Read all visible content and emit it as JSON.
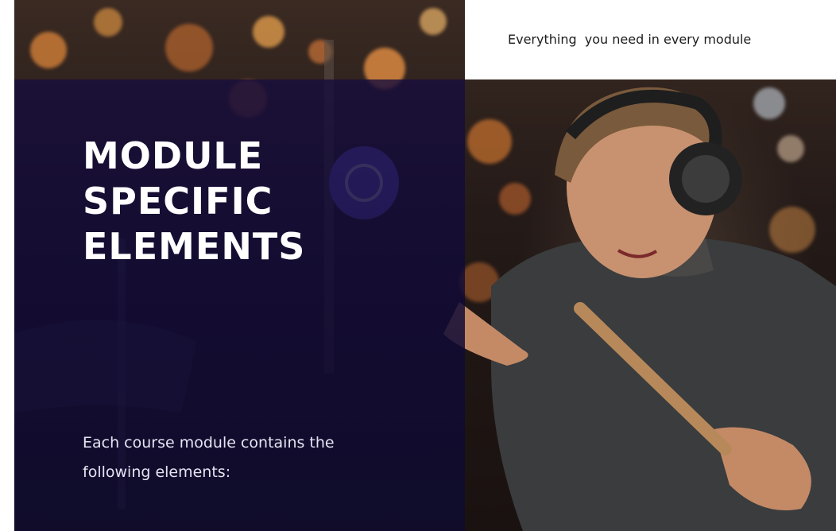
{
  "tagline": "Everything  you need in every module",
  "title_lines": [
    "MODULE",
    "SPECIFIC",
    "ELEMENTS"
  ],
  "subtitle": "Each course module contains the following elements:",
  "colors": {
    "overlay": "#1a0f3c",
    "accent_cymbal": "#6a5ae0",
    "bokeh": "#e08a3a"
  },
  "image": {
    "icon": "drummer-with-headphones-image"
  }
}
